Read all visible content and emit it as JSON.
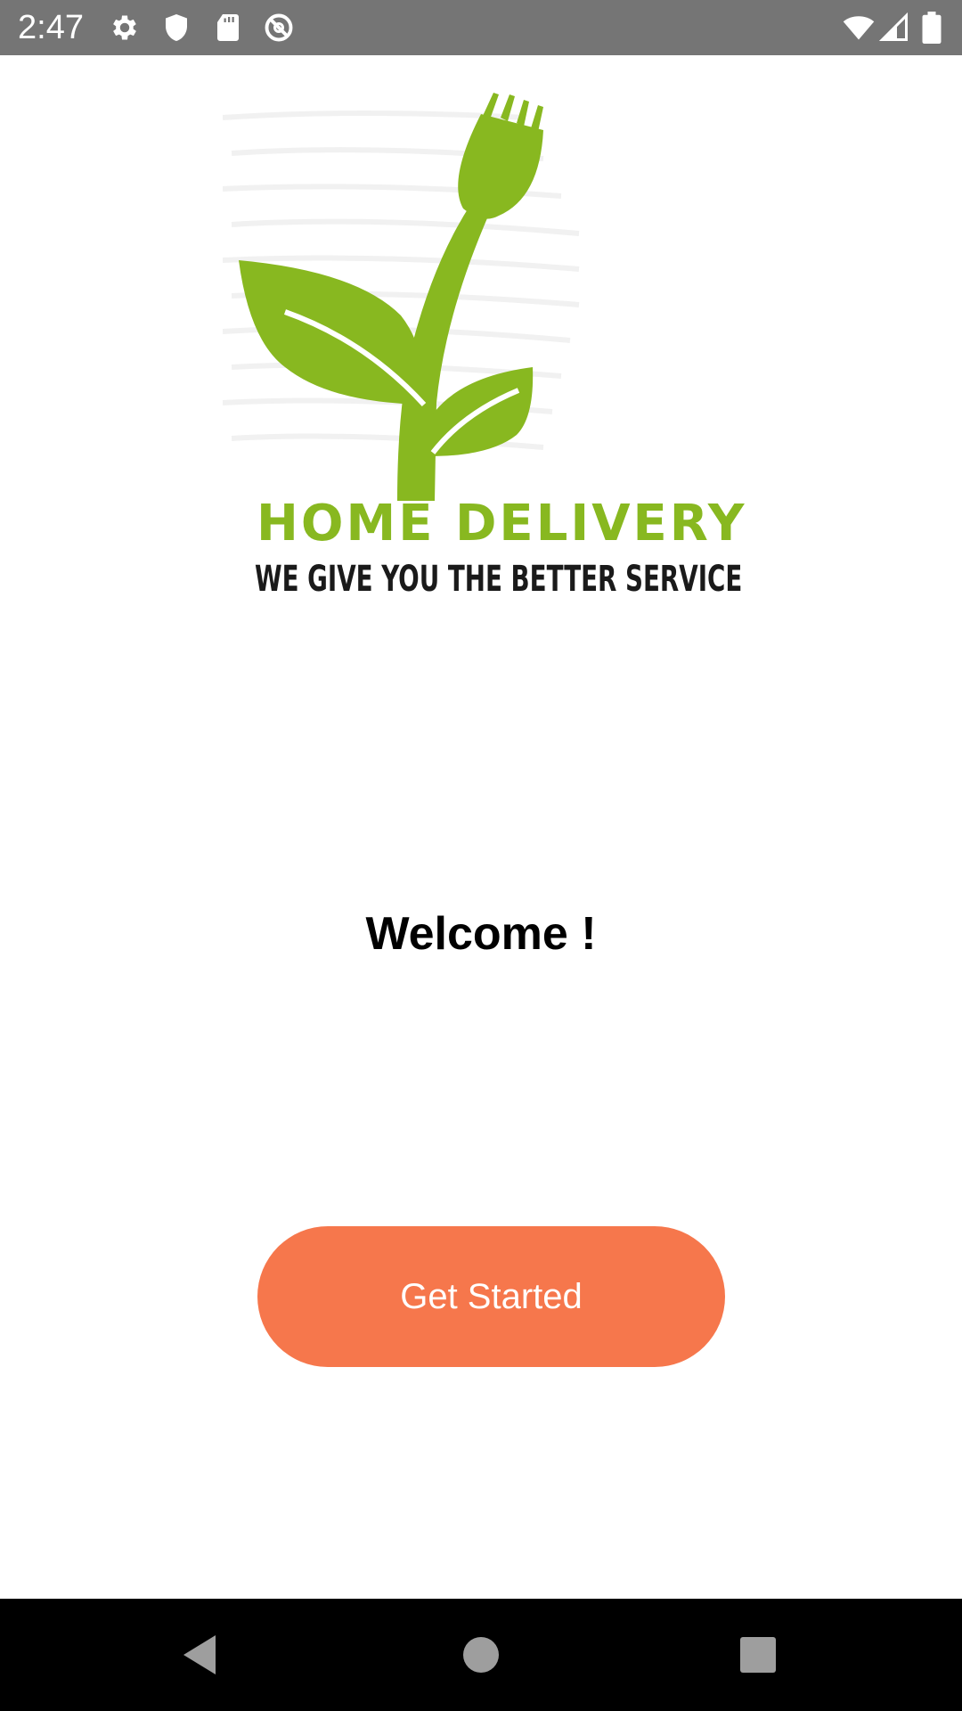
{
  "status_bar": {
    "time": "2:47",
    "left_icons": [
      "settings-icon",
      "shield-icon",
      "sd-card-icon",
      "do-not-disturb-icon"
    ],
    "right_icons": [
      "wifi-icon",
      "cell-signal-icon",
      "battery-icon"
    ]
  },
  "logo": {
    "title": "HOME DELIVERY",
    "tagline": "WE GIVE YOU THE BETTER SERVICE",
    "graphic": "fork-plant-logo",
    "colors": {
      "green": "#88b820",
      "text_dark": "#1a1a1a"
    }
  },
  "welcome": {
    "text": "Welcome !"
  },
  "button": {
    "label": "Get Started",
    "color": "#f6774c",
    "text_color": "#ffffff"
  },
  "nav_bar": {
    "buttons": [
      "back-icon",
      "home-icon",
      "recents-icon"
    ]
  }
}
